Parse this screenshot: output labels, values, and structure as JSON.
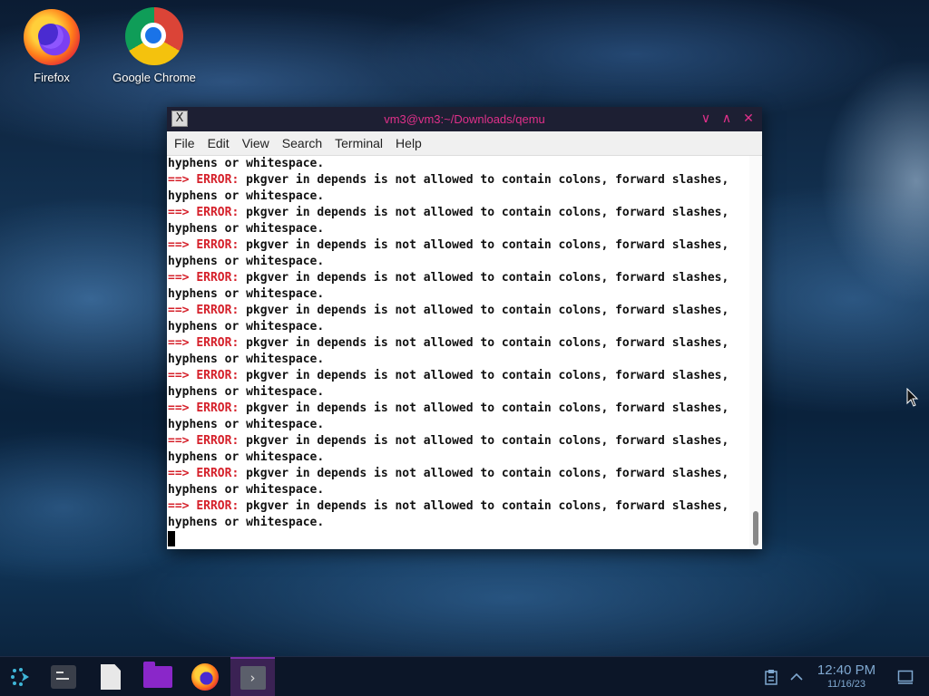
{
  "desktop": {
    "icons": [
      {
        "label": "Firefox",
        "icon": "firefox-icon"
      },
      {
        "label": "Google Chrome",
        "icon": "chrome-icon"
      }
    ]
  },
  "window": {
    "title": "vm3@vm3:~/Downloads/qemu",
    "app_icon": "x-terminal-icon",
    "controls": {
      "minimize": "∨",
      "maximize": "∧",
      "close": "✕"
    }
  },
  "menu": [
    "File",
    "Edit",
    "View",
    "Search",
    "Terminal",
    "Help"
  ],
  "terminal": {
    "first_line": "hyphens or whitespace.",
    "prefix": "==> ",
    "error_tag": "ERROR:",
    "error_message": " pkgver in depends is not allowed to contain colons, forward slashes,",
    "continuation": "hyphens or whitespace.",
    "error_repeat_count": 11
  },
  "taskbar": {
    "items": [
      "launcher-icon",
      "terminal-app-icon",
      "text-editor-icon",
      "file-manager-icon",
      "firefox-icon",
      "konsole-icon"
    ],
    "active_index": 5
  },
  "tray": {
    "clipboard_icon": "clipboard-icon",
    "expand_icon": "chevron-up-icon",
    "show_desktop_icon": "show-desktop-icon"
  },
  "clock": {
    "time": "12:40 PM",
    "date": "11/16/23"
  },
  "colors": {
    "title_accent": "#e0308a",
    "error_red": "#d5202a",
    "taskbar_active": "#3b2254"
  }
}
